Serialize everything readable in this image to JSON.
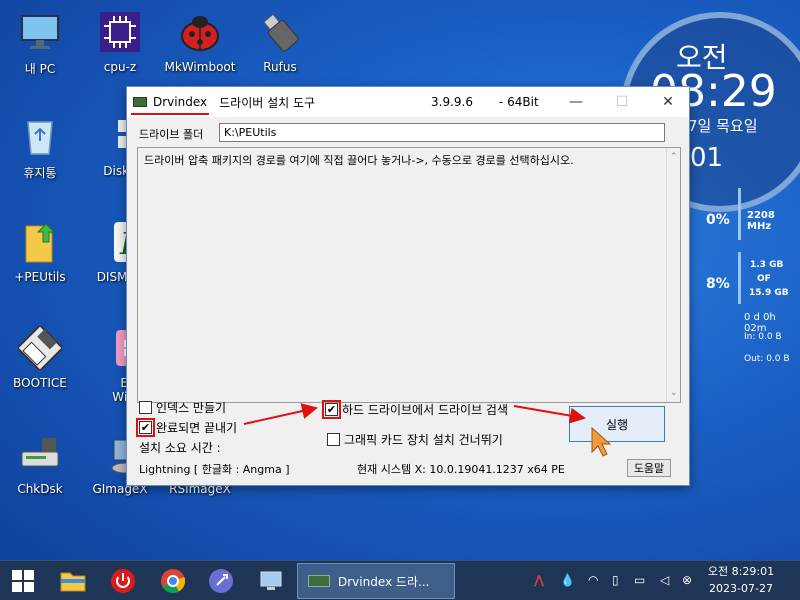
{
  "desktop_icons": [
    {
      "label": "내 PC",
      "icon": "monitor-icon"
    },
    {
      "label": "cpu-z",
      "icon": "cpu-chip-icon"
    },
    {
      "label": "MkWimboot",
      "icon": "ladybug-icon"
    },
    {
      "label": "Rufus",
      "icon": "usb-drive-icon"
    },
    {
      "label": "휴지통",
      "icon": "recycle-bin-icon"
    },
    {
      "label": "Diskp",
      "icon": "grid-icon"
    },
    {
      "label": "+PEUtils",
      "icon": "folder-up-icon"
    },
    {
      "label": "DISM at",
      "icon": "dism-icon"
    },
    {
      "label": "BOOTICE",
      "icon": "floppy-icon"
    },
    {
      "label": "Eas",
      "label2": "WinSe",
      "icon": "windows-tile-icon"
    },
    {
      "label": "ChkDsk",
      "icon": "disk-drive-icon"
    },
    {
      "label": "GImageX",
      "icon": "gimagex-icon"
    },
    {
      "label": "RSImageX",
      "icon": ""
    }
  ],
  "clock_widget": {
    "ampm": "오전",
    "time": "08:29",
    "date_partial": "7일 목요일",
    "day_partial": "01"
  },
  "system_monitor": {
    "cpu_percent": "0%",
    "cpu_freq": "2208 MHz",
    "mem_percent": "8%",
    "mem_used": "1.3 GB",
    "mem_of": "OF",
    "mem_total": "15.9 GB",
    "uptime": "0 d 0h 02m",
    "net_in": "In: 0.0 B",
    "net_out": "Out: 0.0 B"
  },
  "window": {
    "app_name": "Drvindex",
    "title": "드라이버 설치 도구",
    "version": "3.9.9.6",
    "arch": "- 64Bit",
    "minimize": "—",
    "maximize": "☐",
    "close": "✕",
    "folder_label": "드라이브 폴더",
    "folder_value": "K:\\PEUtils",
    "drop_hint": "드라이버 압축 패키지의 경로를 여기에 직접 끌어다 놓거나->, 수동으로 경로를 선택하십시오.",
    "scroll_up": "⌃",
    "scroll_down": "⌄",
    "options": {
      "make_index": {
        "label": "인덱스 만들기",
        "checked": false
      },
      "exit_when_done": {
        "label": "완료되면 끝내기",
        "checked": true
      },
      "search_hdd": {
        "label": "하드 드라이브에서 드라이브 검색",
        "checked": true
      },
      "skip_graphics": {
        "label": "그래픽 카드 장치 설치 건너뛰기",
        "checked": false
      }
    },
    "check_mark": "✔",
    "install_time_label": "설치 소요 시간 :",
    "run_button": "실행",
    "status_left": "Lightning  [ 한글화 : Angma ]",
    "status_system": "현재 시스템 X: 10.0.19041.1237 x64  PE",
    "help_button": "도움말"
  },
  "taskbar": {
    "task_label": "Drvindex   드라...",
    "clock_ampm_time": "오전 8:29:01",
    "clock_date": "2023-07-27"
  },
  "colors": {
    "annotation_red": "#e01010",
    "taskbar_bg": "#1e3556",
    "desktop_blue": "#1a5fc4"
  }
}
